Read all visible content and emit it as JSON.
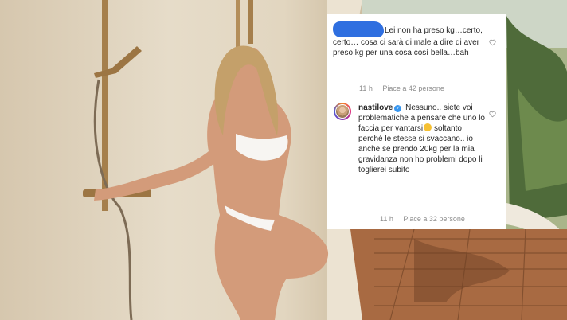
{
  "comments": [
    {
      "redacted_username": true,
      "text": "Lei non ha preso kg…certo, certo… cosa ci sarà di male a dire di aver preso kg per una cosa così bella…bah",
      "time": "11 h",
      "likes": "Piace a 42 persone",
      "like_icon": "heart-outline-icon"
    },
    {
      "username": "nastilove",
      "verified": true,
      "text": "Nessuno.. siete voi problematiche a pensare che uno lo faccia per vantarsi",
      "emoji": "grinning-sweat-emoji",
      "text_after": "soltanto perché le stesse si svaccano.. io anche se prendo 20kg per la mia gravidanza non ho problemi dopo li toglierei subito",
      "time": "11 h",
      "likes": "Piace a 32 persone",
      "like_icon": "heart-outline-icon"
    }
  ],
  "colors": {
    "card_bg": "#ffffff",
    "text": "#262626",
    "meta_text": "#8e8e8e",
    "redaction": "#2f6fe0",
    "verified_badge": "#3897f0"
  }
}
